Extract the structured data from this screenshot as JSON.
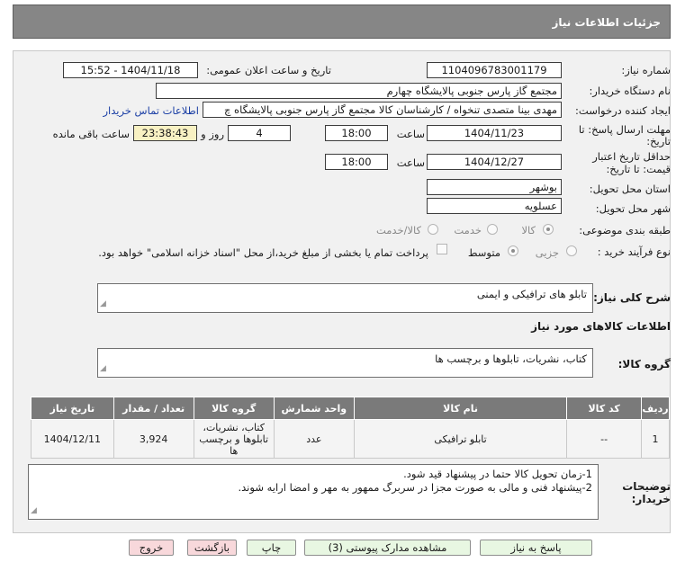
{
  "header": {
    "title": "جزئیات اطلاعات نیاز"
  },
  "form": {
    "need_number_label": "شماره نیاز:",
    "need_number": "1104096783001179",
    "announce_label": "تاریخ و ساعت اعلان عمومی:",
    "announce_value": "1404/11/18 - 15:52",
    "buyer_org_label": "نام دستگاه خریدار:",
    "buyer_org": "مجتمع گاز پارس جنوبی  پالایشگاه چهارم",
    "creator_label": "ایجاد کننده درخواست:",
    "creator": "مهدی بینا متصدی تنخواه / کارشناسان کالا مجتمع گاز پارس جنوبی  پالایشگاه چ",
    "contact_link": "اطلاعات تماس خریدار",
    "reply_deadline_label_1": "مهلت ارسال پاسخ: تا",
    "reply_deadline_label_2": "تاریخ:",
    "reply_date": "1404/11/23",
    "time_label": "ساعت",
    "reply_time": "18:00",
    "days": "4",
    "days_label": "روز و",
    "remaining": "23:38:43",
    "remaining_label": "ساعت باقی مانده",
    "price_validity_label_1": "حداقل تاریخ اعتبار",
    "price_validity_label_2": "قیمت: تا تاریخ:",
    "validity_date": "1404/12/27",
    "validity_time": "18:00",
    "province_label": "استان محل تحویل:",
    "province": "بوشهر",
    "city_label": "شهر محل تحویل:",
    "city": "عسلویه",
    "category_label": "طبقه بندی موضوعی:",
    "category_options": [
      "کالا",
      "خدمت",
      "کالا/خدمت"
    ],
    "category_selected": "کالا",
    "process_label": "نوع فرآیند خرید :",
    "process_options": [
      "جزیی",
      "متوسط"
    ],
    "process_selected": "متوسط",
    "payment_note": "پرداخت تمام یا بخشی از مبلغ خرید،از محل \"اسناد خزانه اسلامی\" خواهد بود."
  },
  "description": {
    "label": "شرح کلی نیاز:",
    "value": "تابلو های ترافیکی و ایمنی"
  },
  "goods_info": {
    "title": "اطلاعات کالاهای مورد نیاز",
    "group_label": "گروه کالا:",
    "group_value": "کتاب، نشریات، تابلوها و برچسب ها"
  },
  "table": {
    "headers": [
      "ردیف",
      "کد کالا",
      "نام کالا",
      "واحد شمارش",
      "گروه کالا",
      "تعداد / مقدار",
      "تاریخ نیاز"
    ],
    "rows": [
      {
        "row": "1",
        "code": "--",
        "name": "تابلو ترافیکی",
        "unit": "عدد",
        "group": "کتاب، نشریات، تابلوها و برچسب ها",
        "qty": "3,924",
        "date": "1404/12/11"
      }
    ]
  },
  "buyer_notes": {
    "label_1": "توضیحات",
    "label_2": "خریدار:",
    "line1": "1-زمان تحویل کالا حتما در پیشنهاد قید شود.",
    "line2": "2-پیشنهاد فنی و مالی به صورت مجزا در سربرگ ممهور به مهر و امضا ارایه شوند."
  },
  "buttons": {
    "reply": "پاسخ به نیاز",
    "docs": "مشاهده مدارک پیوستی (3)",
    "print": "چاپ",
    "back": "بازگشت",
    "exit": "خروج"
  }
}
